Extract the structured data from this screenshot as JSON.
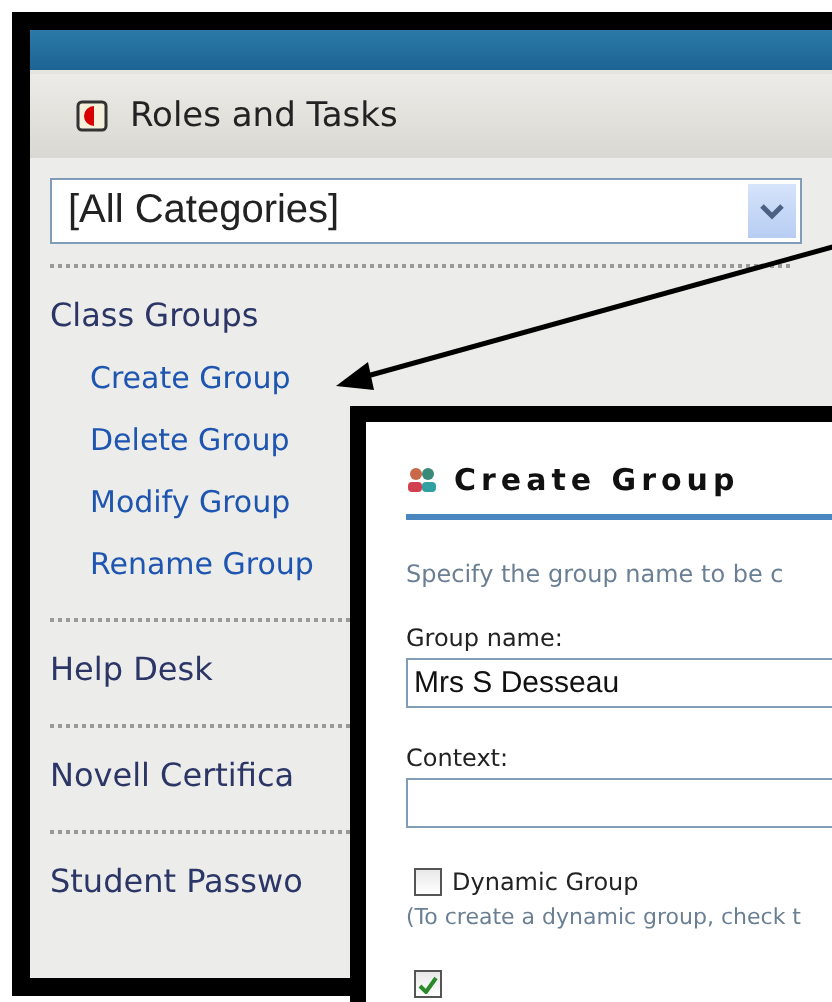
{
  "panel": {
    "title": "Roles and Tasks",
    "category_select": {
      "value": "[All Categories]"
    },
    "sections": [
      {
        "label": "Class Groups",
        "items": [
          "Create Group",
          "Delete Group",
          "Modify Group",
          "Rename Group"
        ]
      },
      {
        "label": "Help Desk"
      },
      {
        "label": "Novell Certifica"
      },
      {
        "label": "Student Passwo"
      }
    ]
  },
  "dialog": {
    "title": "Create Group",
    "intro": "Specify the group name to be c",
    "fields": [
      {
        "label": "Group name:",
        "value": "Mrs S Desseau"
      },
      {
        "label": "Context:"
      }
    ],
    "checkboxes": [
      {
        "label": "Dynamic Group",
        "checked": false,
        "hint": "(To create a dynamic group, check t"
      },
      {
        "checked": true
      }
    ]
  }
}
